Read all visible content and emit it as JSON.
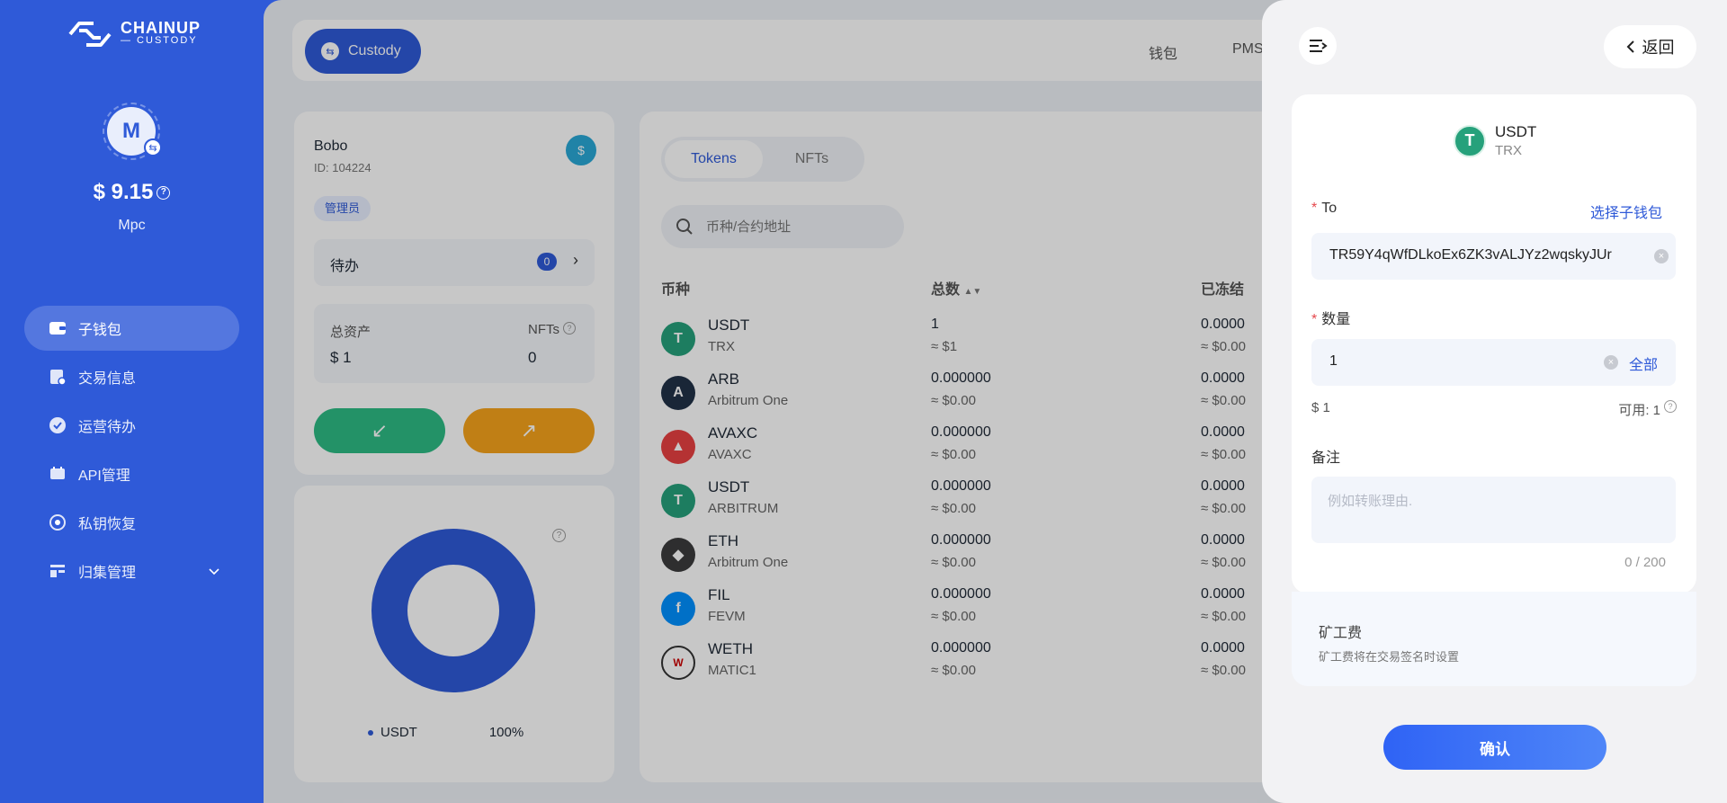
{
  "brand": {
    "line1": "CHAINUP",
    "line2": "— CUSTODY"
  },
  "user": {
    "avatar_letter": "M",
    "balance": "$ 9.15",
    "wallet_type": "Mpc"
  },
  "sidebar": {
    "items": [
      {
        "label": "子钱包",
        "icon": "wallet-icon",
        "active": true
      },
      {
        "label": "交易信息",
        "icon": "transactions-icon"
      },
      {
        "label": "运营待办",
        "icon": "check-circle-icon"
      },
      {
        "label": "API管理",
        "icon": "api-icon"
      },
      {
        "label": "私钥恢复",
        "icon": "key-recovery-icon"
      },
      {
        "label": "归集管理",
        "icon": "collection-icon"
      }
    ]
  },
  "topbar": {
    "custody_label": "Custody",
    "nav": [
      "钱包",
      "PMS"
    ]
  },
  "wallet": {
    "name": "Bobo",
    "id": "ID: 104224",
    "role": "管理员",
    "todo_label": "待办",
    "todo_count": "0",
    "total_assets_label": "总资产",
    "total_assets_value": "$ 1",
    "nfts_label": "NFTs",
    "nfts_value": "0",
    "deposit_icon": "↙",
    "withdraw_icon": "↗"
  },
  "allocation": {
    "legend_label": "USDT",
    "legend_percent": "100%",
    "slices": [
      {
        "name": "USDT",
        "value": 100,
        "color": "#2f5ad8"
      }
    ]
  },
  "tokens": {
    "tabs": [
      "Tokens",
      "NFTs"
    ],
    "search_placeholder": "币种/合约地址",
    "headers": {
      "coin": "币种",
      "total": "总数",
      "frozen": "已冻结"
    },
    "rows": [
      {
        "symbol": "USDT",
        "chain": "TRX",
        "amount": "1",
        "usd": "≈ $1",
        "frozen": "0.0000",
        "frozen_usd": "≈ $0.00",
        "color": "#26a17b",
        "glyph": "T"
      },
      {
        "symbol": "ARB",
        "chain": "Arbitrum One",
        "amount": "0.000000",
        "usd": "≈ $0.00",
        "frozen": "0.0000",
        "frozen_usd": "≈ $0.00",
        "color": "#213147",
        "glyph": "A"
      },
      {
        "symbol": "AVAXC",
        "chain": "AVAXC",
        "amount": "0.000000",
        "usd": "≈ $0.00",
        "frozen": "0.0000",
        "frozen_usd": "≈ $0.00",
        "color": "#e84142",
        "glyph": "▲"
      },
      {
        "symbol": "USDT",
        "chain": "ARBITRUM",
        "amount": "0.000000",
        "usd": "≈ $0.00",
        "frozen": "0.0000",
        "frozen_usd": "≈ $0.00",
        "color": "#26a17b",
        "glyph": "T"
      },
      {
        "symbol": "ETH",
        "chain": "Arbitrum One",
        "amount": "0.000000",
        "usd": "≈ $0.00",
        "frozen": "0.0000",
        "frozen_usd": "≈ $0.00",
        "color": "#3c3c3d",
        "glyph": "◆"
      },
      {
        "symbol": "FIL",
        "chain": "FEVM",
        "amount": "0.000000",
        "usd": "≈ $0.00",
        "frozen": "0.0000",
        "frozen_usd": "≈ $0.00",
        "color": "#0090ff",
        "glyph": "f"
      },
      {
        "symbol": "WETH",
        "chain": "MATIC1",
        "amount": "0.000000",
        "usd": "≈ $0.00",
        "frozen": "0.0000",
        "frozen_usd": "≈ $0.00",
        "color": "#ffffff",
        "glyph": "W"
      }
    ]
  },
  "drawer": {
    "back_label": "返回",
    "token_symbol": "USDT",
    "token_chain": "TRX",
    "to_label": "To",
    "choose_subwallet": "选择子钱包",
    "to_value": "TR59Y4qWfDLkoEx6ZK3vALJYz2wqskyJUr",
    "amount_label": "数量",
    "amount_value": "1",
    "all_label": "全部",
    "usd_value": "$ 1",
    "available": "可用: 1",
    "memo_label": "备注",
    "memo_placeholder": "例如转账理由.",
    "memo_counter": "0 / 200",
    "fee_title": "矿工费",
    "fee_sub": "矿工费将在交易签名时设置",
    "confirm_label": "确认"
  }
}
